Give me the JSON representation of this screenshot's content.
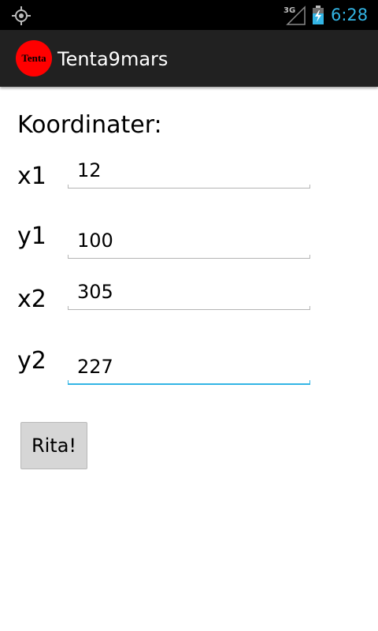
{
  "status_bar": {
    "time": "6:28",
    "network_label": "3G",
    "icons": [
      "gps-icon",
      "signal-3g-icon",
      "battery-charging-icon"
    ],
    "accent_color": "#33b5e5"
  },
  "action_bar": {
    "logo_text": "Tenta",
    "title": "Tenta9mars",
    "logo_color": "#ff0000"
  },
  "form": {
    "heading": "Koordinater:",
    "fields": [
      {
        "label": "x1",
        "value": "12"
      },
      {
        "label": "y1",
        "value": "100"
      },
      {
        "label": "x2",
        "value": "305"
      },
      {
        "label": "y2",
        "value": "227",
        "focused": true
      }
    ],
    "button_label": "Rita!"
  }
}
